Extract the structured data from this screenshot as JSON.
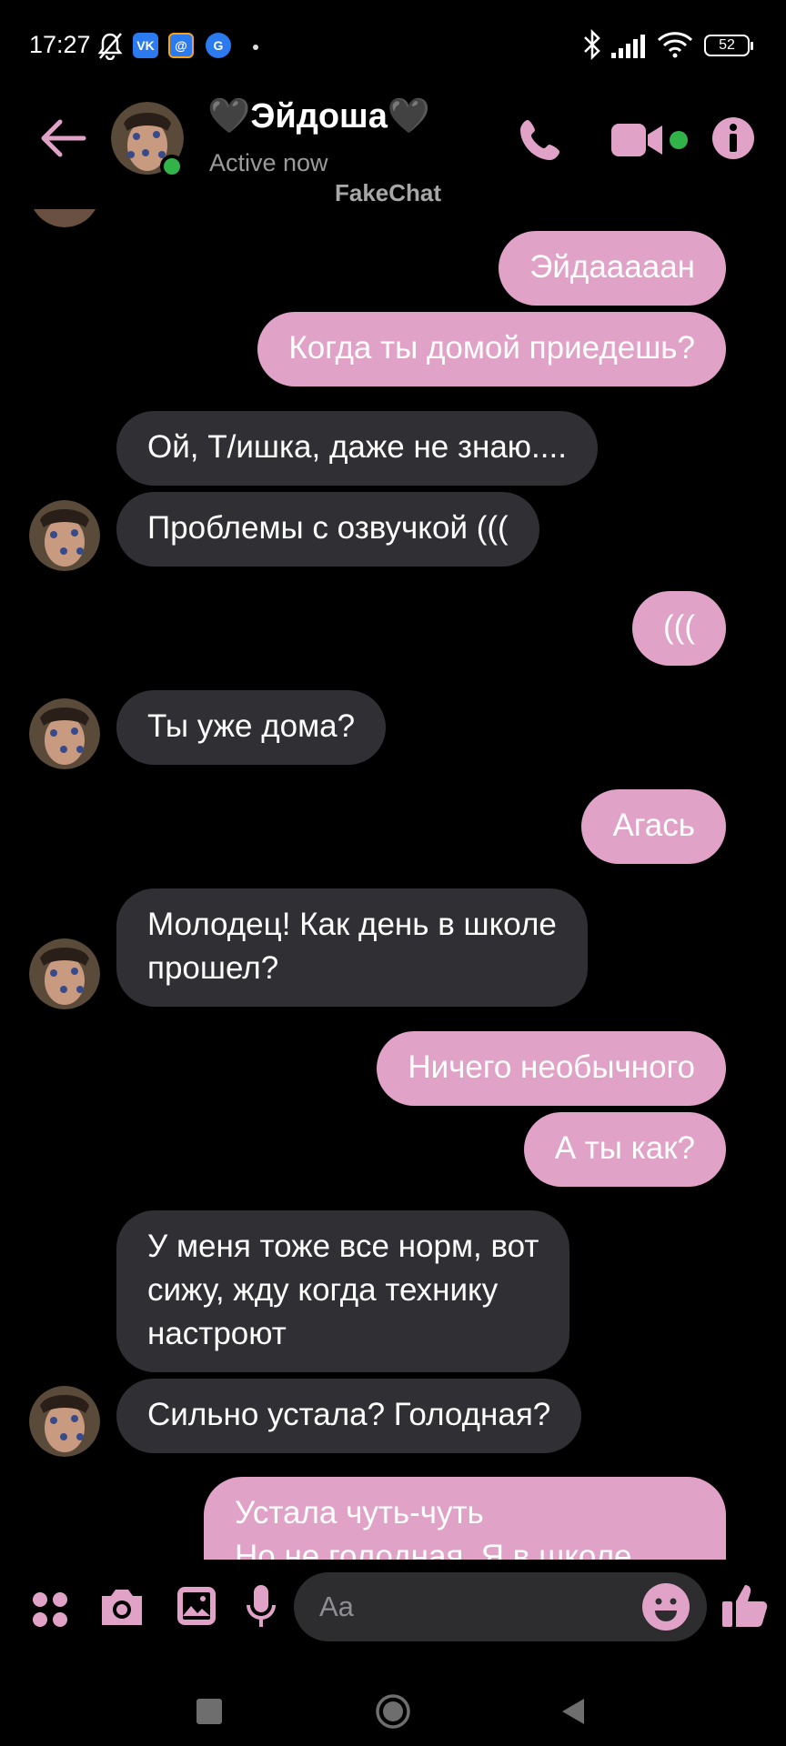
{
  "status_bar": {
    "time": "17:27",
    "battery": "52",
    "apps": [
      {
        "label": "VK",
        "color": "#2b7af0"
      },
      {
        "label": "@",
        "color": "#f7a21b"
      },
      {
        "label": "G",
        "color": "#2b7af0"
      }
    ]
  },
  "header": {
    "contact_name": "🖤Эйдоша🖤",
    "status": "Active now",
    "watermark": "FakeChat"
  },
  "colors": {
    "accent": "#e0a2c6",
    "incoming_bubble": "#303034",
    "online": "#32b34a"
  },
  "messages": [
    {
      "side": "out",
      "text": "Эйдааааан"
    },
    {
      "side": "out",
      "text": "Когда ты домой приедешь?"
    },
    {
      "side": "in",
      "text": "Ой, Т/ишка, даже не знаю...."
    },
    {
      "side": "in",
      "text": "Проблемы с озвучкой ((("
    },
    {
      "side": "out",
      "text": "((("
    },
    {
      "side": "in",
      "text": "Ты уже дома?"
    },
    {
      "side": "out",
      "text": "Агась"
    },
    {
      "side": "in",
      "lines": [
        "Молодец! Как день в школе",
        "прошел?"
      ]
    },
    {
      "side": "out",
      "text": "Ничего необычного"
    },
    {
      "side": "out",
      "text": "А ты как?"
    },
    {
      "side": "in",
      "lines": [
        "У меня тоже все норм, вот",
        "сижу, жду когда технику",
        "настроют"
      ]
    },
    {
      "side": "in",
      "text": "Сильно устала? Голодная?"
    },
    {
      "side": "out",
      "lines": [
        "Устала чуть-чуть",
        "Но не голодная. Я в школе"
      ]
    }
  ],
  "composer": {
    "placeholder": "Aa",
    "icons": [
      "menu-icon",
      "camera-icon",
      "gallery-icon",
      "microphone-icon",
      "emoji-icon",
      "thumbs-up-icon"
    ]
  },
  "nav": {
    "buttons": [
      "recents-button",
      "home-button",
      "back-button"
    ]
  }
}
